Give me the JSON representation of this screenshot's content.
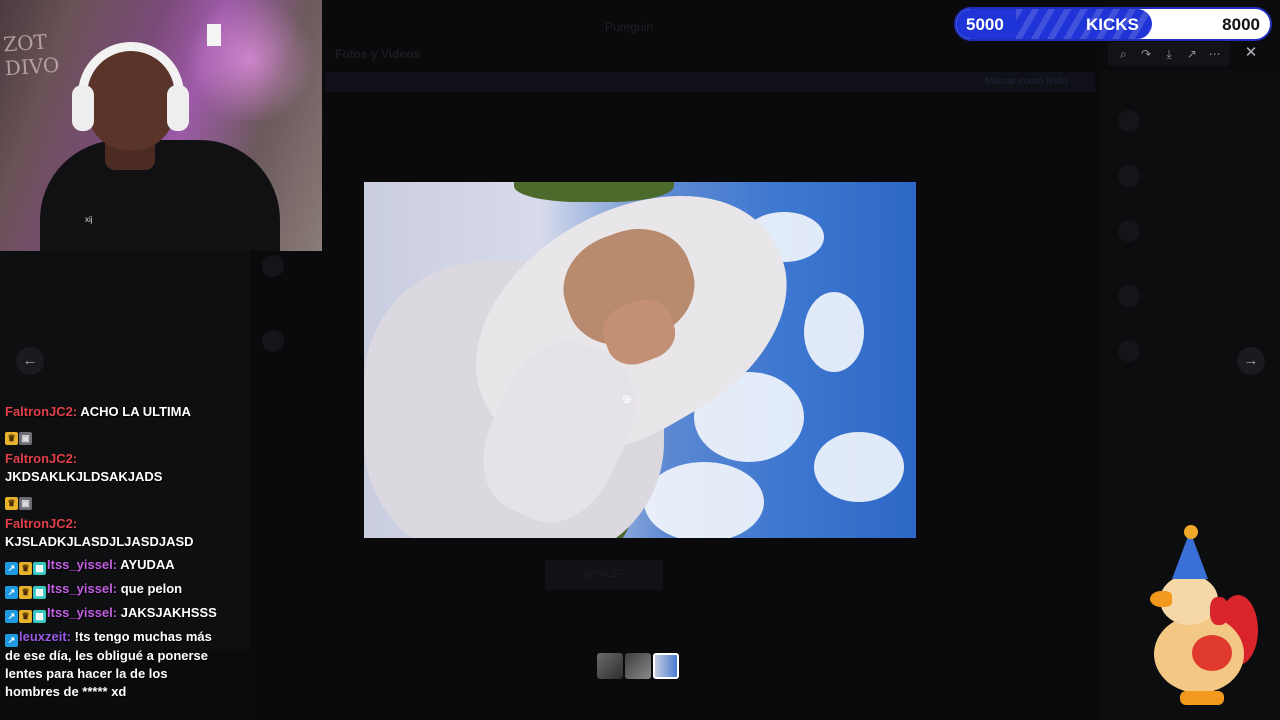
{
  "background": {
    "channel_title": "Pureguin",
    "section_heading": "Fotos y Videos",
    "banner_action": "Marcar como leído",
    "spoiler_label": "SPOILER"
  },
  "kicks": {
    "current": "5000",
    "label": "KICKS",
    "goal": "8000",
    "progress": 0.625,
    "fill_color": "#1f34d6"
  },
  "toolbar": {
    "zoom_icon": "zoom-in-icon",
    "forward_icon": "forward-icon",
    "download_icon": "download-icon",
    "open_icon": "open-external-icon",
    "more_icon": "more-icon",
    "close_icon": "close-icon"
  },
  "navigation": {
    "prev_icon": "arrow-left-icon",
    "next_icon": "arrow-right-icon"
  },
  "webcam": {
    "wall_text": "ZOT DIVO",
    "shirt_text": "xij"
  },
  "chat": [
    {
      "badges": [],
      "user": "FaltronJC2:",
      "user_color": "#e0414a",
      "text": "ACHO LA ULTIMA"
    },
    {
      "badges": [
        "crown",
        "game"
      ],
      "user": "",
      "user_color": "#ffffff",
      "text": ""
    },
    {
      "badges": [],
      "user": "FaltronJC2:",
      "user_color": "#e0414a",
      "text": "JKDSAKLKJLDSAKJADS"
    },
    {
      "badges": [
        "crown",
        "game"
      ],
      "user": "",
      "user_color": "#ffffff",
      "text": ""
    },
    {
      "badges": [],
      "user": "FaltronJC2:",
      "user_color": "#e0414a",
      "text": "KJSLADKJLASDJLJASDJASD"
    },
    {
      "badges": [
        "blue",
        "crown",
        "teal"
      ],
      "user": "Itss_yissel:",
      "user_color": "#c060e0",
      "text": "AYUDAA"
    },
    {
      "badges": [
        "blue",
        "crown",
        "teal"
      ],
      "user": "Itss_yissel:",
      "user_color": "#c060e0",
      "text": "que pelon"
    },
    {
      "badges": [
        "blue",
        "crown",
        "teal"
      ],
      "user": "Itss_yissel:",
      "user_color": "#c060e0",
      "text": "JAKSJAKHSSS"
    },
    {
      "badges": [
        "blue"
      ],
      "user": "leuxzeit:",
      "user_color": "#9a5ae6",
      "text": "!ts tengo muchas más de ese día, les obligué a ponerse lentes para hacer la de los hombres de ***** xd"
    }
  ],
  "thumbnails": [
    "photo-1",
    "photo-2",
    "photo-3"
  ]
}
